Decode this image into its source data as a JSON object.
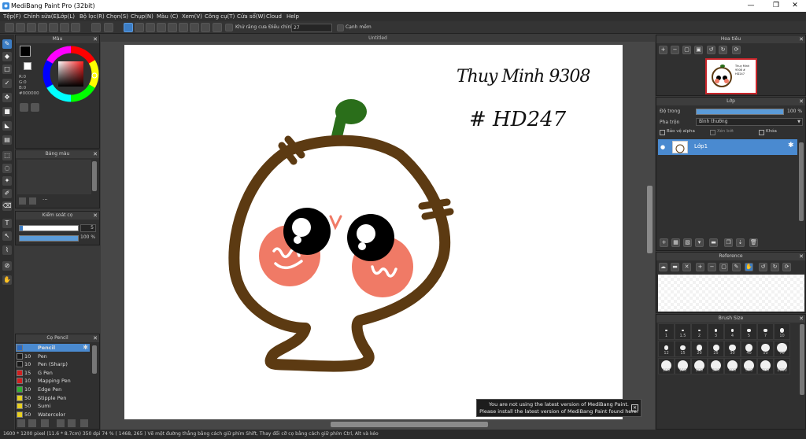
{
  "window": {
    "title": "MediBang Paint Pro (32bit)",
    "min": "—",
    "max": "❐",
    "close": "✕"
  },
  "menu": [
    "Tệp(F)",
    "Chỉnh sửa(E)",
    "Lớp(L)",
    "Bộ lọc(R)",
    "Chọn(S)",
    "Chụp(N)",
    "Màu (C)",
    "Xem(V)",
    "Công cụ(T)",
    "Cửa sổ(W)",
    "Cloud",
    "Help"
  ],
  "toolbar": {
    "antialias_label": "Khử răng cưa",
    "adjust_label": "Điều chỉnh",
    "adjust_value": "27",
    "soft_edge_label": "Cạnh mềm"
  },
  "color_panel": {
    "title": "Màu",
    "r": "R:0",
    "g": "G:0",
    "b": "B:0",
    "hex": "#000000"
  },
  "palette_panel": {
    "title": "Bảng màu",
    "more": "···"
  },
  "brush_control": {
    "title": "Kiểm soát cọ",
    "size": "5",
    "opacity": "100 %"
  },
  "brush_panel": {
    "title": "Cọ Pencil",
    "items": [
      {
        "size": "",
        "name": "Pencil",
        "color": "#2a6ac0"
      },
      {
        "size": "10",
        "name": "Pen",
        "color": "#1a1a1a"
      },
      {
        "size": "10",
        "name": "Pen (Sharp)",
        "color": "#1a1a1a"
      },
      {
        "size": "15",
        "name": "G Pen",
        "color": "#d02020"
      },
      {
        "size": "10",
        "name": "Mapping Pen",
        "color": "#d02020"
      },
      {
        "size": "10",
        "name": "Edge Pen",
        "color": "#30b030"
      },
      {
        "size": "50",
        "name": "Stipple Pen",
        "color": "#e8d020"
      },
      {
        "size": "50",
        "name": "Sumi",
        "color": "#e8d020"
      },
      {
        "size": "50",
        "name": "Watercolor",
        "color": "#e8d020"
      }
    ]
  },
  "canvas": {
    "tab_title": "Untitled",
    "text_line1": "Thuy Minh 9308",
    "text_line2": "# HD247"
  },
  "navigator": {
    "title": "Hoa tiêu",
    "thumb_text": "Thuy Minh 9308 # HD247"
  },
  "layer_panel": {
    "title": "Lớp",
    "opacity_label": "Độ trong",
    "opacity_value": "100 %",
    "blend_label": "Pha trộn",
    "blend_value": "Bình thường",
    "protect_alpha": "Bảo vệ alpha",
    "clipping": "Xén bớt",
    "lock": "Khóa",
    "layer_name": "Lớp1"
  },
  "reference_panel": {
    "title": "Reference"
  },
  "brush_size_panel": {
    "title": "Brush Size",
    "sizes": [
      "1",
      "1.5",
      "2",
      "3",
      "4",
      "5",
      "7",
      "10",
      "12",
      "15",
      "20",
      "25",
      "30",
      "40",
      "50",
      "70",
      "100",
      "150",
      "200",
      "300",
      "400",
      "500",
      "700",
      "1000"
    ]
  },
  "notice": {
    "line1": "You are not using the latest version of MediBang Paint.",
    "line2": "Please install the latest version of MediBang Paint found here."
  },
  "status": "1600 * 1200 pixel   (11.6 * 8.7cm)   350 dpi   74 %   ( 1468, 265 )   Vẽ một đường thẳng bằng cách giữ phím Shift, Thay đổi cỡ cọ bằng cách giữ phím Ctrl, Alt và kéo"
}
